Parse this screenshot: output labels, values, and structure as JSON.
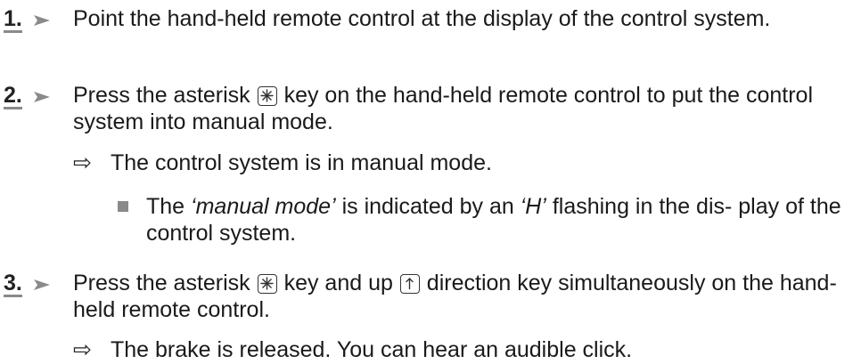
{
  "steps": [
    {
      "number": "1.",
      "text": "Point the hand-held remote control at the display of the control system."
    },
    {
      "number": "2.",
      "text_before_key": "Press the asterisk ",
      "key_icon": "asterisk-key-icon",
      "text_after_key": " key on the hand-held remote control to put the control system into manual mode.",
      "result": "The control system is in manual mode.",
      "bullet": {
        "text_1": "The ",
        "emphasis_1": "‘manual mode’",
        "text_2": " is indicated by an ",
        "emphasis_2": "‘H’",
        "text_3": " flashing in the dis- play of the control system."
      }
    },
    {
      "number": "3.",
      "text_before_key1": "Press the asterisk ",
      "key1_icon": "asterisk-key-icon",
      "text_between_keys": " key and up ",
      "key2_icon": "up-arrow-key-icon",
      "text_after_keys": " direction key simultaneously on the hand-held remote control.",
      "result": "The brake is released. You can hear an audible click."
    }
  ],
  "result_symbol": "⇨",
  "colors": {
    "text": "#1a1a1a",
    "accent_gray": "#8a8a8a"
  }
}
